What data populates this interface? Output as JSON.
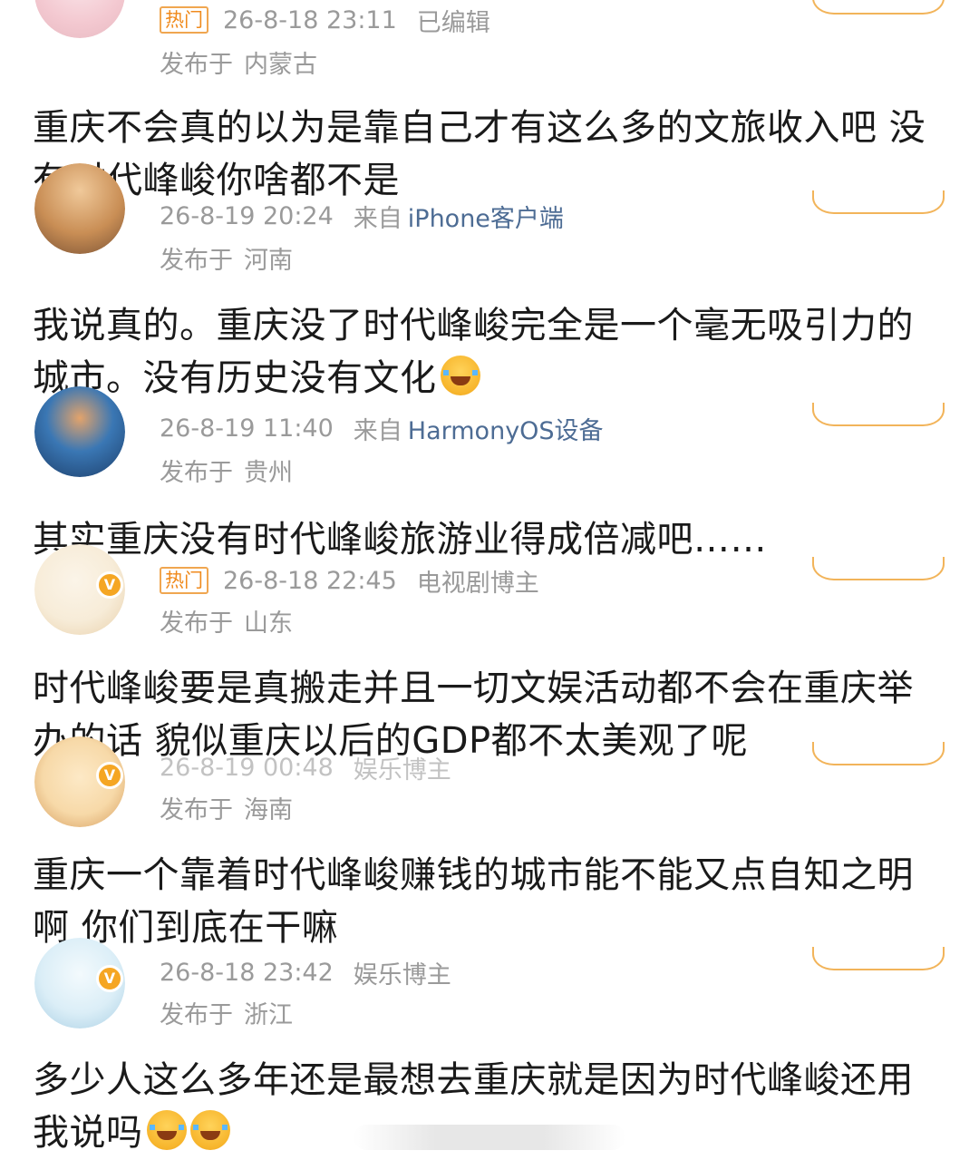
{
  "comments": [
    {
      "hot_label": "热门",
      "time": "26-8-18 23:11",
      "extra": "已编辑",
      "source_prefix": "",
      "source_client": "",
      "location_label": "发布于",
      "location": "内蒙古",
      "text": "重庆不会真的以为是靠自己才有这么多的文旅收入吧 没有时代峰峻你啥都不是",
      "emoji_count": 0,
      "verified": false,
      "avatar_colors": [
        "#f6d7dc",
        "#e7b9c1"
      ]
    },
    {
      "hot_label": "",
      "time": "26-8-19 20:24",
      "extra": "",
      "source_prefix": "来自",
      "source_client": "iPhone客户端",
      "location_label": "发布于",
      "location": "河南",
      "text": "我说真的。重庆没了时代峰峻完全是一个毫无吸引力的城市。没有历史没有文化",
      "emoji_count": 1,
      "emoji_name": "laugh-cry-emoji",
      "verified": false,
      "avatar_colors": [
        "#c98e55",
        "#7a5234"
      ]
    },
    {
      "hot_label": "",
      "time": "26-8-19 11:40",
      "extra": "",
      "source_prefix": "来自",
      "source_client": "HarmonyOS设备",
      "location_label": "发布于",
      "location": "贵州",
      "text": "其实重庆没有时代峰峻旅游业得成倍减吧……",
      "emoji_count": 0,
      "verified": false,
      "avatar_colors": [
        "#2b6aa6",
        "#1d3f6b"
      ]
    },
    {
      "hot_label": "热门",
      "time": "26-8-18 22:45",
      "extra": "电视剧博主",
      "source_prefix": "",
      "source_client": "",
      "location_label": "发布于",
      "location": "山东",
      "text": "时代峰峻要是真搬走并且一切文娱活动都不会在重庆举办的话 貌似重庆以后的GDP都不太美观了呢",
      "emoji_count": 0,
      "verified": true,
      "avatar_colors": [
        "#f7ecd8",
        "#e8cfa9"
      ]
    },
    {
      "hot_label": "",
      "time": "26-8-19 00:48",
      "extra": "娱乐博主",
      "source_prefix": "",
      "source_client": "",
      "location_label": "发布于",
      "location": "海南",
      "text": "重庆一个靠着时代峰峻赚钱的城市能不能又点自知之明啊 你们到底在干嘛",
      "emoji_count": 0,
      "verified": true,
      "avatar_colors": [
        "#f7d9a8",
        "#d49a5a"
      ]
    },
    {
      "hot_label": "",
      "time": "26-8-18 23:42",
      "extra": "娱乐博主",
      "source_prefix": "",
      "source_client": "",
      "location_label": "发布于",
      "location": "浙江",
      "text": "多少人这么多年还是最想去重庆就是因为时代峰峻还用我说吗",
      "emoji_count": 2,
      "emoji_name": "laugh-cry-emoji",
      "verified": true,
      "avatar_colors": [
        "#dbeef7",
        "#a9cfe4"
      ]
    }
  ],
  "colors": {
    "accent_orange": "#f08a1c",
    "meta_gray": "#9a9a9a",
    "client_blue": "#4d6c94",
    "verified_badge": "#f5a623"
  },
  "icons": {
    "verified_badge": "verified-v-icon",
    "like_indicator": "like-arc-icon"
  }
}
